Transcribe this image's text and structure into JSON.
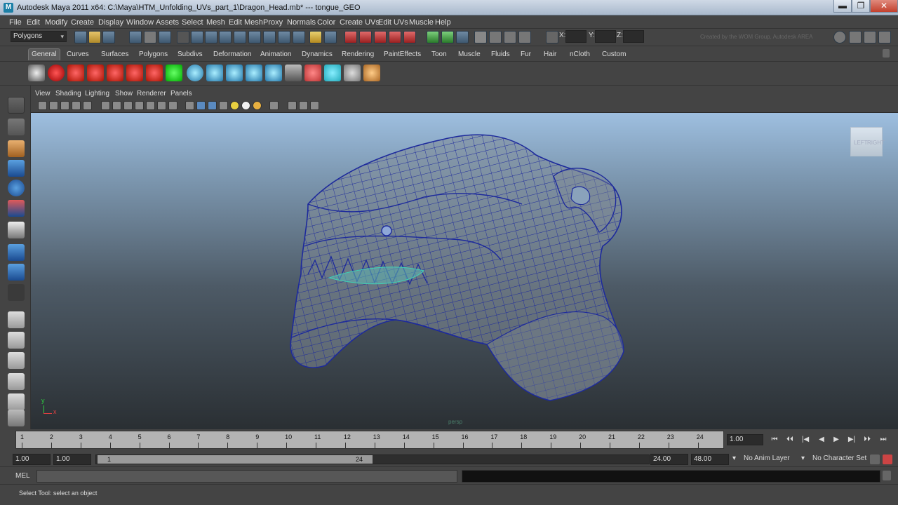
{
  "window": {
    "title": "Autodesk Maya 2011 x64: C:\\Maya\\HTM_Unfolding_UVs_part_1\\Dragon_Head.mb*   ---   tongue_GEO",
    "app_icon": "maya-icon",
    "minimize": "▬",
    "maximize": "❐",
    "close": "✕"
  },
  "menubar": {
    "items": [
      "File",
      "Edit",
      "Modify",
      "Create",
      "Display",
      "Window",
      "Assets",
      "Select",
      "Mesh",
      "Edit Mesh",
      "Proxy",
      "Normals",
      "Color",
      "Create UVs",
      "Edit UVs",
      "Muscle",
      "Help"
    ]
  },
  "statusline": {
    "mode": "Polygons",
    "x_label": "X:",
    "y_label": "Y:",
    "z_label": "Z:",
    "faint_text": "Created by the WOM Group, Autodesk AREA"
  },
  "shelf": {
    "tabs": [
      "General",
      "Curves",
      "Surfaces",
      "Polygons",
      "Subdivs",
      "Deformation",
      "Animation",
      "Dynamics",
      "Rendering",
      "PaintEffects",
      "Toon",
      "Muscle",
      "Fluids",
      "Fur",
      "Hair",
      "nCloth",
      "Custom"
    ],
    "active_tab": "General"
  },
  "panel": {
    "menus": [
      "View",
      "Shading",
      "Lighting",
      "Show",
      "Renderer",
      "Panels"
    ]
  },
  "viewport": {
    "viewcube_left": "LEFT",
    "viewcube_right": "RIGHT",
    "axis_y": "y",
    "axis_x": "x",
    "mesh_label": "persp",
    "wire_color": "#1d2a9c",
    "background_top": "#9ebfe0",
    "background_bottom": "#2a2f33"
  },
  "timeslider": {
    "ticks": [
      "1",
      "2",
      "3",
      "4",
      "5",
      "6",
      "7",
      "8",
      "9",
      "10",
      "11",
      "12",
      "13",
      "14",
      "15",
      "16",
      "17",
      "18",
      "19",
      "20",
      "21",
      "22",
      "23",
      "24"
    ],
    "current_frame": "1.00",
    "buttons": [
      "⏮",
      "⏴⏴",
      "|◀",
      "◀",
      "▶",
      "▶|",
      "⏵⏵",
      "⏭"
    ]
  },
  "rangeslider": {
    "start_time": "1.00",
    "playback_start": "1.00",
    "range_start_label": "1",
    "range_end_label": "24",
    "playback_end": "24.00",
    "end_time": "48.00",
    "anim_layer": "No Anim Layer",
    "character_set": "No Character Set"
  },
  "commandline": {
    "label": "MEL"
  },
  "helpline": {
    "text": "Select Tool: select an object"
  }
}
